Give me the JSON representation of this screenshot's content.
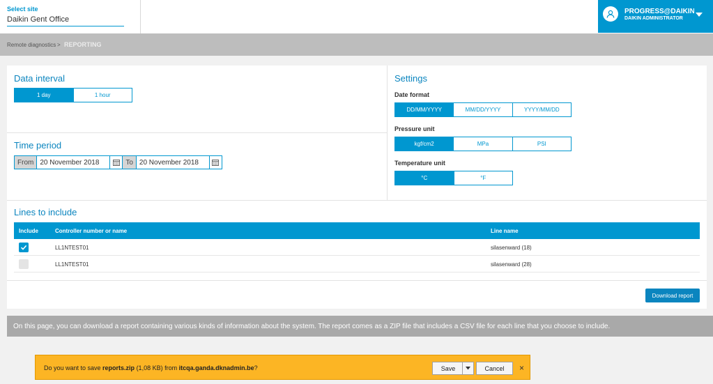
{
  "header": {
    "site_label": "Select site",
    "site_value": "Daikin Gent Office",
    "user_name": "PROGRESS@DAIKIN...",
    "user_role": "DAIKIN ADMINISTRATOR",
    "avatar_icon": "user-icon"
  },
  "breadcrumb": {
    "parent": "Remote diagnostics",
    "separator": ">",
    "current": "REPORTING"
  },
  "data_interval": {
    "title": "Data interval",
    "options": [
      "1 day",
      "1 hour"
    ],
    "selected": "1 day"
  },
  "time_period": {
    "title": "Time period",
    "from_label": "From",
    "from_value": "20 November 2018",
    "to_label": "To",
    "to_value": "20 November 2018"
  },
  "settings": {
    "title": "Settings",
    "date_format": {
      "label": "Date format",
      "options": [
        "DD/MM/YYYY",
        "MM/DD/YYYY",
        "YYYY/MM/DD"
      ],
      "selected": "DD/MM/YYYY"
    },
    "pressure_unit": {
      "label": "Pressure unit",
      "options": [
        "kgf/cm2",
        "MPa",
        "PSI"
      ],
      "selected": "kgf/cm2"
    },
    "temperature_unit": {
      "label": "Temperature unit",
      "options": [
        "°C",
        "°F"
      ],
      "selected": "°C"
    }
  },
  "lines": {
    "title": "Lines to include",
    "columns": [
      "Include",
      "Controller number or name",
      "Line name"
    ],
    "rows": [
      {
        "include": true,
        "controller": "LL1NTEST01",
        "line": "silasenward (18)"
      },
      {
        "include": false,
        "controller": "LL1NTEST01",
        "line": "silasenward (28)"
      }
    ]
  },
  "download_button": "Download report",
  "info_text": "On this page, you can download a report containing various kinds of information about the system. The report comes as a ZIP file that includes a CSV file for each line that you choose to include.",
  "download_bar": {
    "prefix": "Do you want to save ",
    "file": "reports.zip",
    "size": " (1,08 KB) from ",
    "host": "itcqa.ganda.dknadmin.be",
    "suffix": "?",
    "save_label": "Save",
    "cancel_label": "Cancel",
    "close_label": "×"
  },
  "colors": {
    "accent": "#0097d0",
    "title_blue": "#0b85bf",
    "download_bar": "#fcb524"
  }
}
